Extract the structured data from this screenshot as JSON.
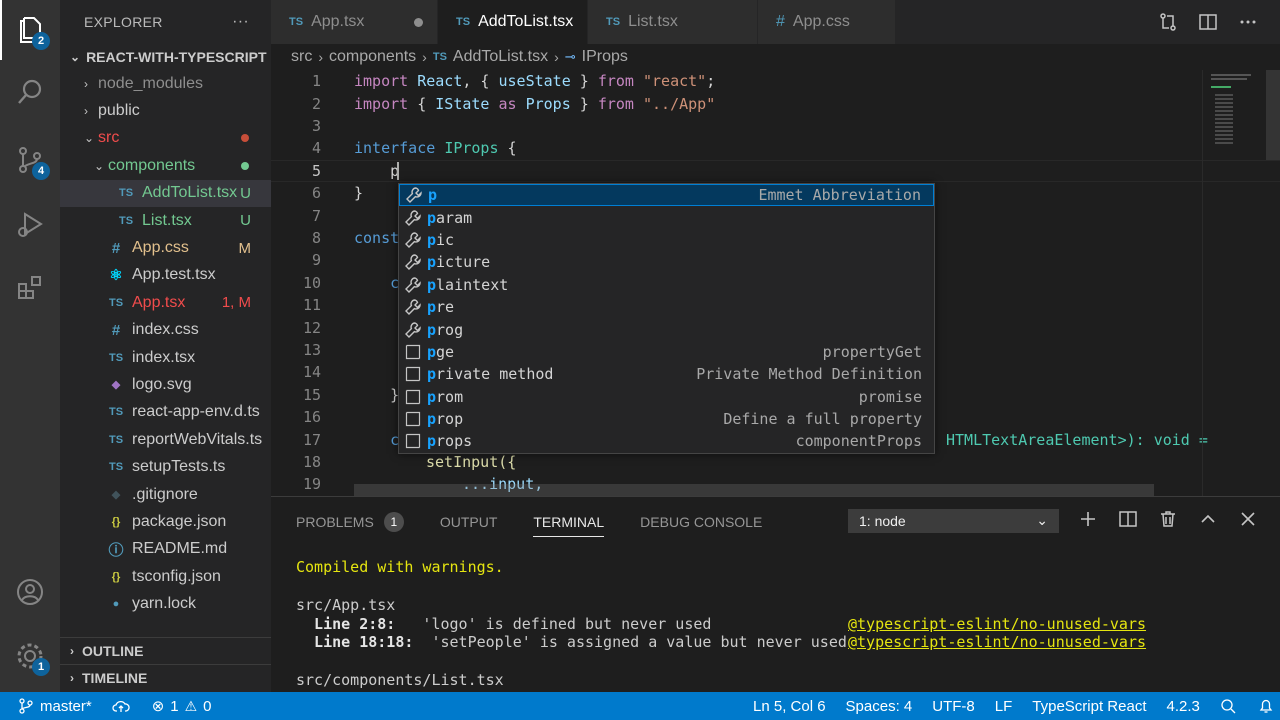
{
  "activity_bar": {
    "explorer_badge": "2",
    "scm_badge": "4",
    "settings_badge": "1"
  },
  "sidebar": {
    "title": "EXPLORER",
    "more": "···",
    "project": "REACT-WITH-TYPESCRIPT",
    "items": [
      {
        "label": "node_modules",
        "type": "folder",
        "color": "#8e8e8e"
      },
      {
        "label": "public",
        "type": "folder",
        "color": "#cccccc"
      },
      {
        "label": "src",
        "type": "folder-open",
        "color": "#f14c4c",
        "dot": "#c74e39"
      },
      {
        "label": "components",
        "type": "folder-open",
        "color": "#73c991",
        "dot": "#73c991"
      },
      {
        "label": "AddToList.tsx",
        "type": "ts",
        "color": "#73c991",
        "status": "U"
      },
      {
        "label": "List.tsx",
        "type": "ts",
        "color": "#73c991",
        "status": "U"
      },
      {
        "label": "App.css",
        "type": "css",
        "color": "#e2c08d",
        "status": "M"
      },
      {
        "label": "App.test.tsx",
        "type": "react",
        "color": "#cccccc"
      },
      {
        "label": "App.tsx",
        "type": "ts",
        "color": "#f14c4c",
        "status": "1, M"
      },
      {
        "label": "index.css",
        "type": "css",
        "color": "#cccccc"
      },
      {
        "label": "index.tsx",
        "type": "ts",
        "color": "#cccccc"
      },
      {
        "label": "logo.svg",
        "type": "svg",
        "color": "#cccccc"
      },
      {
        "label": "react-app-env.d.ts",
        "type": "ts",
        "color": "#cccccc"
      },
      {
        "label": "reportWebVitals.ts",
        "type": "ts",
        "color": "#cccccc"
      },
      {
        "label": "setupTests.ts",
        "type": "ts",
        "color": "#cccccc"
      },
      {
        "label": ".gitignore",
        "type": "git",
        "color": "#cccccc"
      },
      {
        "label": "package.json",
        "type": "json",
        "color": "#cccccc"
      },
      {
        "label": "README.md",
        "type": "info",
        "color": "#cccccc"
      },
      {
        "label": "tsconfig.json",
        "type": "json",
        "color": "#cccccc"
      },
      {
        "label": "yarn.lock",
        "type": "yarn",
        "color": "#cccccc"
      }
    ],
    "outline": "OUTLINE",
    "timeline": "TIMELINE"
  },
  "tabs": [
    {
      "label": "App.tsx",
      "prefix": "TS",
      "modified": true,
      "active": false
    },
    {
      "label": "AddToList.tsx",
      "prefix": "TS",
      "modified": true,
      "active": true
    },
    {
      "label": "List.tsx",
      "prefix": "TS",
      "modified": false,
      "active": false
    },
    {
      "label": "App.css",
      "prefix": "#",
      "modified": false,
      "active": false
    }
  ],
  "breadcrumb": {
    "src": "src",
    "components": "components",
    "file_prefix": "TS",
    "file": "AddToList.tsx",
    "symbol": "IProps"
  },
  "editor": {
    "line_numbers": [
      "1",
      "2",
      "3",
      "4",
      "5",
      "6",
      "7",
      "8",
      "9",
      "10",
      "11",
      "12",
      "13",
      "14",
      "15",
      "16",
      "17",
      "18",
      "19"
    ],
    "line17_tail": "HTMLTextAreaElement>): void =",
    "line18": "setInput({",
    "line19": "...input,"
  },
  "suggest": [
    {
      "match": "p",
      "rest": "",
      "detail": "Emmet Abbreviation",
      "icon": "wrench"
    },
    {
      "match": "p",
      "rest": "aram",
      "detail": "",
      "icon": "wrench"
    },
    {
      "match": "p",
      "rest": "ic",
      "detail": "",
      "icon": "wrench"
    },
    {
      "match": "p",
      "rest": "icture",
      "detail": "",
      "icon": "wrench"
    },
    {
      "match": "p",
      "rest": "laintext",
      "detail": "",
      "icon": "wrench"
    },
    {
      "match": "p",
      "rest": "re",
      "detail": "",
      "icon": "wrench"
    },
    {
      "match": "p",
      "rest": "rog",
      "detail": "",
      "icon": "wrench"
    },
    {
      "match": "p",
      "rest": "ge",
      "detail": "propertyGet",
      "icon": "snippet"
    },
    {
      "match": "p",
      "rest": "rivate method",
      "detail": "Private Method Definition",
      "icon": "snippet"
    },
    {
      "match": "p",
      "rest": "rom",
      "detail": "promise",
      "icon": "snippet"
    },
    {
      "match": "p",
      "rest": "rop",
      "detail": "Define a full property",
      "icon": "snippet"
    },
    {
      "match": "p",
      "rest": "rops",
      "detail": "componentProps",
      "icon": "snippet"
    }
  ],
  "panel": {
    "tabs": [
      "PROBLEMS",
      "OUTPUT",
      "TERMINAL",
      "DEBUG CONSOLE"
    ],
    "problems_count": "1",
    "terminal_select": "1: node",
    "terminal": {
      "compiled": "Compiled with warnings.",
      "file1": "src/App.tsx",
      "w1_loc": "  Line 2:8:",
      "w1_msg": "   'logo' is defined but never used",
      "w1_rule": "@typescript-eslint/no-unused-vars",
      "w2_loc": "  Line 18:18:",
      "w2_msg": "  'setPeople' is assigned a value but never used",
      "w2_rule": "@typescript-eslint/no-unused-vars",
      "file2": "src/components/List.tsx"
    }
  },
  "statusbar": {
    "branch": "master*",
    "errors": "1",
    "warnings": "0",
    "position": "Ln 5, Col 6",
    "spaces": "Spaces: 4",
    "encoding": "UTF-8",
    "eol": "LF",
    "language": "TypeScript React",
    "version": "4.2.3"
  }
}
